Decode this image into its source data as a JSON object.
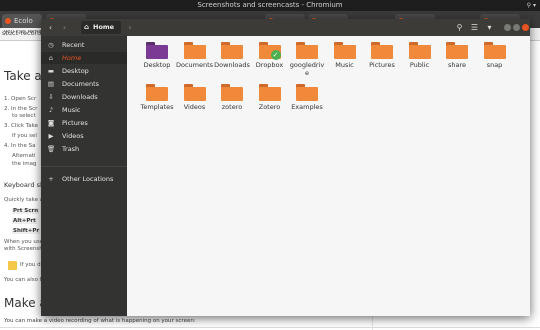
{
  "top_bar": {
    "title": "Screenshots and screencasts - Chromium"
  },
  "tabs": [
    {
      "label": "Ecolo"
    },
    {
      "label": ""
    },
    {
      "label": ""
    },
    {
      "label": ""
    },
    {
      "label": ""
    },
    {
      "label": ""
    }
  ],
  "address": {
    "text": "stuct-record.h"
  },
  "page": {
    "you_can": "you can remove",
    "heading": "Take a s",
    "steps": [
      "1. Open Scr",
      "2. In the Scr",
      "to select",
      "3. Click Take",
      "If you sel",
      "4. In the Sa",
      "Alternati",
      "the imag"
    ],
    "kbd_title": "Keyboard sh",
    "quickly": "Quickly take a",
    "keys": [
      "Prt Scrn",
      "Alt+Prt",
      "Shift+Pr"
    ],
    "when_use": "When you use",
    "with_screens": "with Screensh",
    "if_you_do": "If you d",
    "you_can_also": "You can also ho",
    "heading2": "Make a s",
    "bottom_line": "You can make a video recording of what is happening on your screen:"
  },
  "files": {
    "path_label": "Home",
    "sidebar": [
      {
        "label": "Recent",
        "icon": "clock-icon",
        "active": false
      },
      {
        "label": "Home",
        "icon": "home-icon",
        "active": true
      },
      {
        "label": "Desktop",
        "icon": "folder-icon",
        "active": false
      },
      {
        "label": "Documents",
        "icon": "document-icon",
        "active": false
      },
      {
        "label": "Downloads",
        "icon": "download-icon",
        "active": false
      },
      {
        "label": "Music",
        "icon": "music-icon",
        "active": false
      },
      {
        "label": "Pictures",
        "icon": "camera-icon",
        "active": false
      },
      {
        "label": "Videos",
        "icon": "video-icon",
        "active": false
      },
      {
        "label": "Trash",
        "icon": "trash-icon",
        "active": false
      },
      {
        "label": "Other Locations",
        "icon": "plus-icon",
        "active": false
      }
    ],
    "items": [
      {
        "label": "Desktop",
        "type": "desktop"
      },
      {
        "label": "Documents",
        "type": "folder"
      },
      {
        "label": "Downloads",
        "type": "folder"
      },
      {
        "label": "Dropbox",
        "type": "dropbox"
      },
      {
        "label": "googledriv\ne",
        "type": "folder"
      },
      {
        "label": "Music",
        "type": "folder"
      },
      {
        "label": "Pictures",
        "type": "folder"
      },
      {
        "label": "Public",
        "type": "folder"
      },
      {
        "label": "share",
        "type": "folder"
      },
      {
        "label": "snap",
        "type": "folder"
      },
      {
        "label": "Templates",
        "type": "folder"
      },
      {
        "label": "Videos",
        "type": "folder"
      },
      {
        "label": "zotero",
        "type": "folder"
      },
      {
        "label": "Zotero",
        "type": "folder"
      },
      {
        "label": "Examples",
        "type": "folder"
      }
    ]
  },
  "colors": {
    "accent": "#e95420",
    "folder": "#f08a3a",
    "sidebar": "#333331",
    "header": "#3c3b37"
  }
}
